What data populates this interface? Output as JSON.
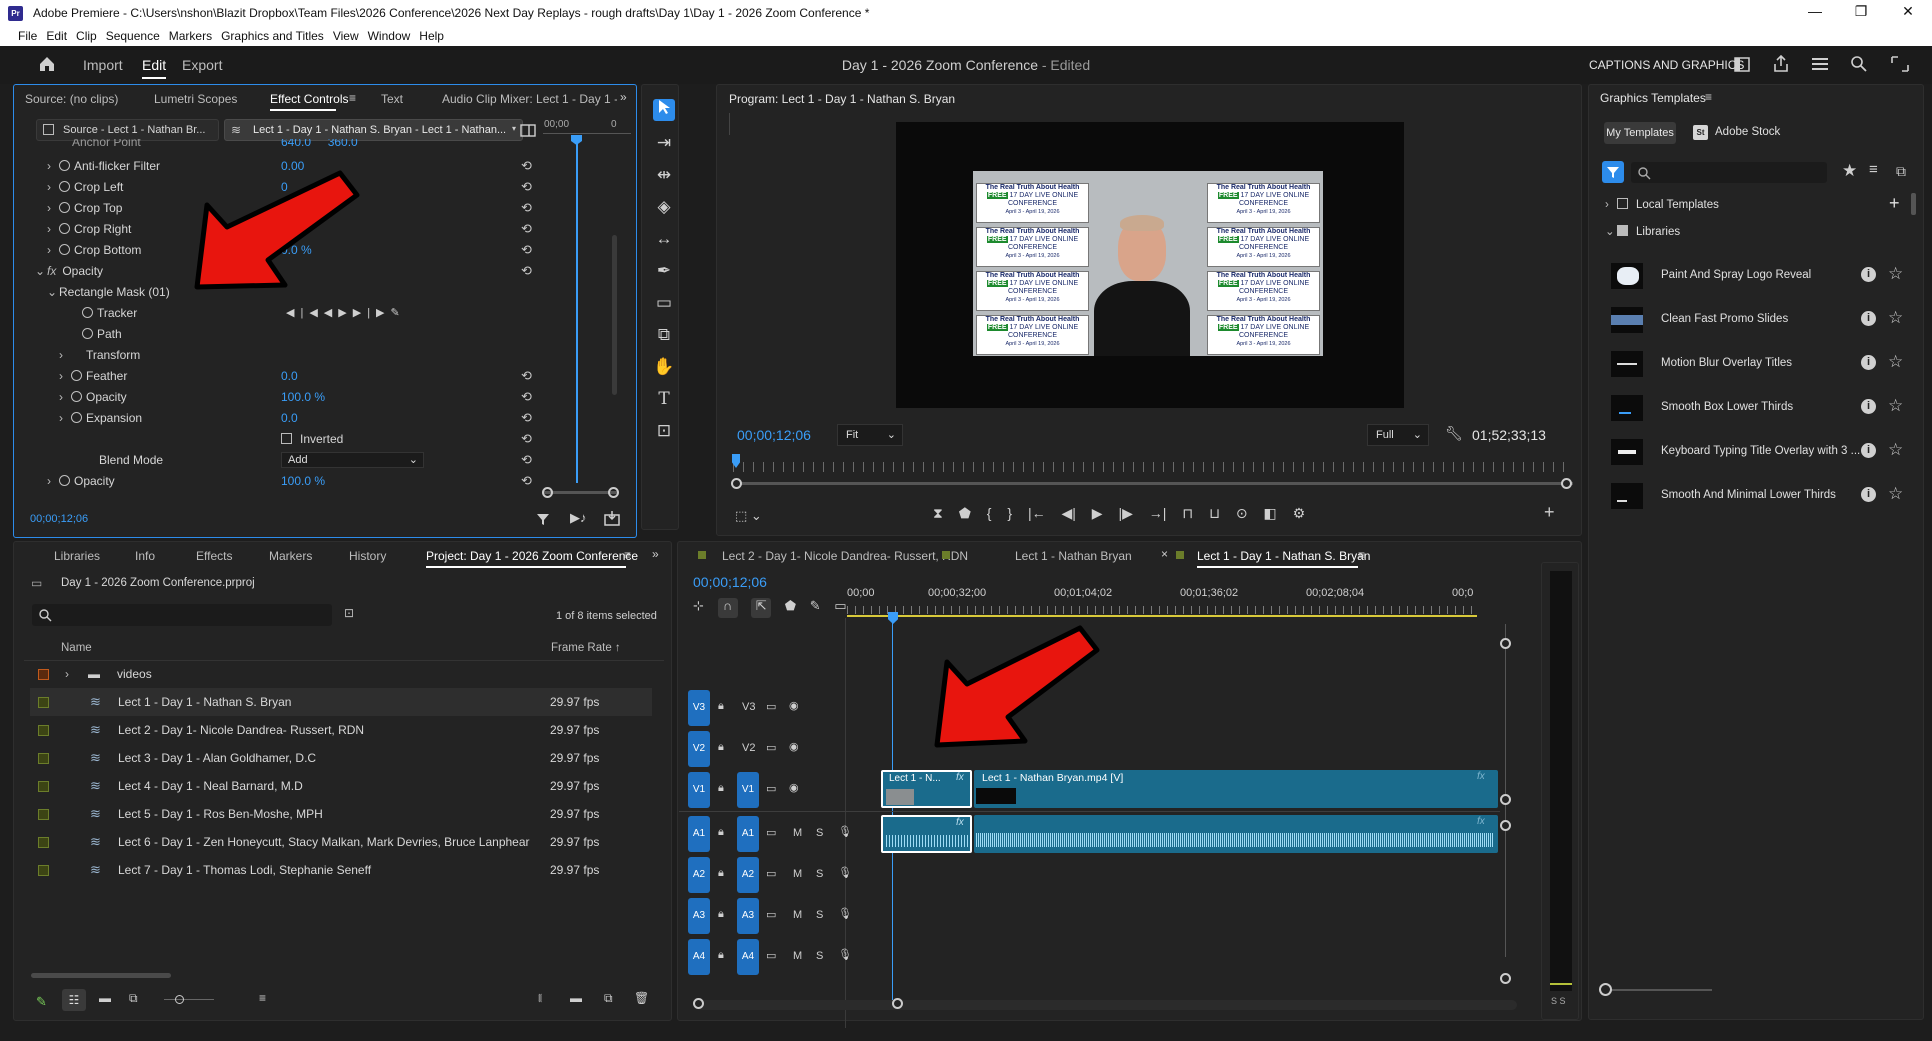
{
  "window": {
    "app_icon": "Pr",
    "title": "Adobe Premiere - C:\\Users\\nshon\\Blazit Dropbox\\Team Files\\2026 Conference\\2026 Next Day Replays - rough drafts\\Day 1\\Day 1 - 2026 Zoom Conference *",
    "minimize": "—",
    "maximize": "❐",
    "close": "✕"
  },
  "menu": [
    "File",
    "Edit",
    "Clip",
    "Sequence",
    "Markers",
    "Graphics and Titles",
    "View",
    "Window",
    "Help"
  ],
  "header": {
    "tabs": [
      "Import",
      "Edit",
      "Export"
    ],
    "active_tab": "Edit",
    "project_title": "Day 1 - 2026 Zoom Conference",
    "edited_suffix": " - Edited",
    "workspace_label": "CAPTIONS AND GRAPHICS"
  },
  "effect_controls": {
    "tabs": [
      "Source: (no clips)",
      "Lumetri Scopes",
      "Effect Controls",
      "Text",
      "Audio Clip Mixer: Lect 1 - Day 1 - N"
    ],
    "source_chip": "Source - Lect 1 - Nathan Br...",
    "sequence_chip": "Lect 1 - Day 1 - Nathan S. Bryan - Lect 1 - Nathan...",
    "mini_timecode": "00;00",
    "partial_top": {
      "label": "Anchor Point",
      "v1": "640.0",
      "v2": "360.0"
    },
    "rows": [
      {
        "label": "Anti-flicker Filter",
        "value": "0.00"
      },
      {
        "label": "Crop Left",
        "value": "0"
      },
      {
        "label": "Crop Top",
        "value": ""
      },
      {
        "label": "Crop Right",
        "value": ""
      },
      {
        "label": "Crop Bottom",
        "value": "0.0 %"
      }
    ],
    "opacity_section": "Opacity",
    "mask_label": "Rectangle Mask (01)",
    "tracker": "Tracker",
    "path": "Path",
    "transform": "Transform",
    "feather": {
      "label": "Feather",
      "value": "0.0"
    },
    "mask_opacity": {
      "label": "Opacity",
      "value": "100.0 %"
    },
    "expansion": {
      "label": "Expansion",
      "value": "0.0"
    },
    "inverted": "Inverted",
    "blend_mode": {
      "label": "Blend Mode",
      "value": "Add"
    },
    "opacity2": {
      "label": "Opacity",
      "value": "100.0 %"
    },
    "timecode": "00;00;12;06"
  },
  "program_monitor": {
    "title": "Program: Lect 1 - Day 1 - Nathan S. Bryan",
    "timecode": "00;00;12;06",
    "fit": "Fit",
    "resolution": "Full",
    "duration": "01;52;33;13",
    "banner_line1": "The Real Truth About Health",
    "banner_free": "FREE",
    "banner_line2": "17 DAY LIVE ONLINE",
    "banner_line3": "CONFERENCE",
    "banner_dates": "April 3 - April 19, 2026"
  },
  "graphics_templates": {
    "title": "Graphics Templates",
    "tabs": [
      "My Templates",
      "Adobe Stock"
    ],
    "stock_icon": "St",
    "tree": [
      "Local Templates",
      "Libraries"
    ],
    "items": [
      "Paint And Spray Logo Reveal",
      "Clean Fast Promo Slides",
      "Motion Blur Overlay Titles",
      "Smooth Box Lower Thirds",
      "Keyboard Typing Title Overlay with 3 ...",
      "Smooth And Minimal Lower Thirds"
    ]
  },
  "project": {
    "tabs": [
      "Libraries",
      "Info",
      "Effects",
      "Markers",
      "History",
      "Project: Day 1 - 2026 Zoom Conference"
    ],
    "file": "Day 1 - 2026 Zoom Conference.prproj",
    "selection": "1 of 8 items selected",
    "col_name": "Name",
    "col_framerate": "Frame Rate",
    "folder": "videos",
    "items": [
      {
        "name": "Lect 1 - Day 1 - Nathan S. Bryan",
        "fps": "29.97 fps"
      },
      {
        "name": "Lect 2 - Day 1- Nicole Dandrea- Russert, RDN",
        "fps": "29.97 fps"
      },
      {
        "name": "Lect 3 - Day 1 - Alan Goldhamer, D.C",
        "fps": "29.97 fps"
      },
      {
        "name": "Lect 4 - Day 1 - Neal Barnard, M.D",
        "fps": "29.97 fps"
      },
      {
        "name": "Lect 5 - Day 1 - Ros Ben-Moshe, MPH",
        "fps": "29.97 fps"
      },
      {
        "name": "Lect 6 - Day 1 - Zen Honeycutt, Stacy Malkan, Mark Devries, Bruce Lanphear",
        "fps": "29.97 fps"
      },
      {
        "name": "Lect 7 - Day 1 - Thomas Lodi, Stephanie Seneff",
        "fps": "29.97 fps"
      }
    ]
  },
  "timeline": {
    "tabs": [
      "Lect 2 - Day 1- Nicole Dandrea- Russert, RDN",
      "Lect 1 - Nathan Bryan",
      "Lect 1 - Day 1 - Nathan S. Bryan"
    ],
    "timecode": "00;00;12;06",
    "ruler": [
      "00;00",
      "00;00;32;00",
      "00;01;04;02",
      "00;01;36;02",
      "00;02;08;04",
      "00;0"
    ],
    "video_tracks": [
      "V3",
      "V2",
      "V1"
    ],
    "audio_tracks": [
      "A1",
      "A2",
      "A3",
      "A4"
    ],
    "clip_short": "Lect 1 - N...",
    "clip_long": "Lect 1 - Nathan Bryan.mp4 [V]",
    "fx": "fx",
    "m": "M",
    "s": "S",
    "meter_label": "S S"
  },
  "colors": {
    "accent": "#2d8ceb",
    "track_blue": "#1f6fbf",
    "clip_teal": "#1a6b8c",
    "arrow_red": "#e8150e",
    "timecode_blue": "#3a9df7"
  }
}
